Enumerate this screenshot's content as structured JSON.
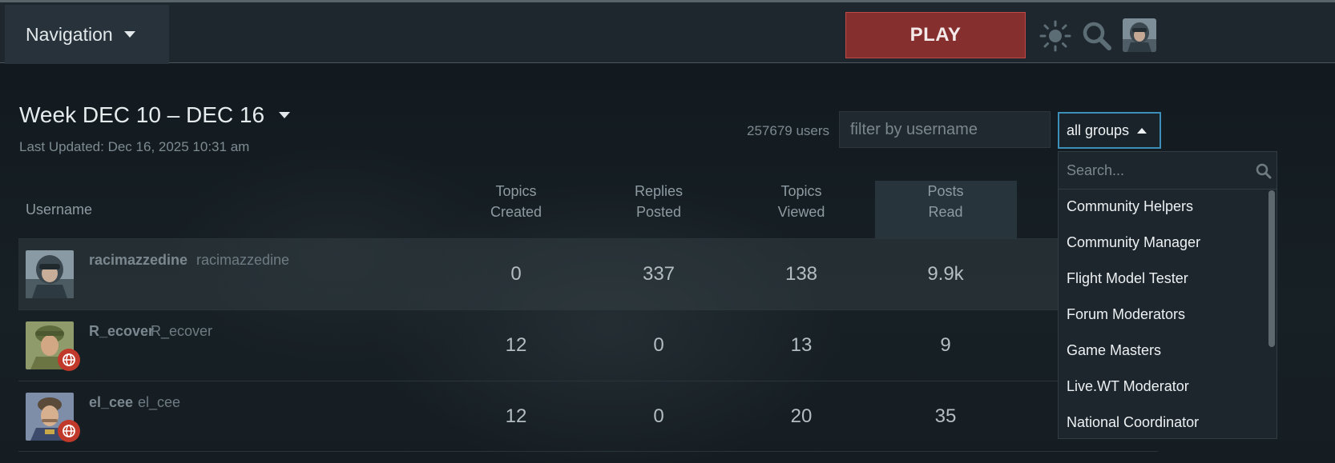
{
  "header": {
    "nav_label": "Navigation",
    "play_label": "PLAY",
    "icons": [
      "sun-icon",
      "search-icon",
      "user-avatar"
    ]
  },
  "title": {
    "week": "Week DEC 10 – DEC 16",
    "last_updated": "Last Updated: Dec 16, 2025 10:31 am"
  },
  "controls": {
    "user_count": "257679 users",
    "filter_placeholder": "filter by username",
    "groups_label": "all groups"
  },
  "table": {
    "headers": {
      "username": "Username",
      "topics_created": [
        "Topics",
        "Created"
      ],
      "replies_posted": [
        "Replies",
        "Posted"
      ],
      "topics_viewed": [
        "Topics",
        "Viewed"
      ],
      "posts_read": [
        "Posts",
        "Read"
      ]
    },
    "rows": [
      {
        "username": "racimazzedine",
        "name": "racimazzedine",
        "topics_created": "0",
        "replies_posted": "337",
        "topics_viewed": "138",
        "posts_read": "9.9k"
      },
      {
        "username": "R_ecover",
        "name": "R_ecover",
        "topics_created": "12",
        "replies_posted": "0",
        "topics_viewed": "13",
        "posts_read": "9"
      },
      {
        "username": "el_cee",
        "name": "el_cee",
        "topics_created": "12",
        "replies_posted": "0",
        "topics_viewed": "20",
        "posts_read": "35"
      }
    ]
  },
  "dropdown": {
    "search_placeholder": "Search...",
    "items": [
      "Community Helpers",
      "Community Manager",
      "Flight Model Tester",
      "Forum Moderators",
      "Game Masters",
      "Live.WT Moderator",
      "National Coordinator"
    ]
  },
  "colors": {
    "play_bg": "#862f2f",
    "accent_border": "#3b8fb8",
    "header_bg": "#1d272d",
    "badge_red": "#c0392b"
  }
}
